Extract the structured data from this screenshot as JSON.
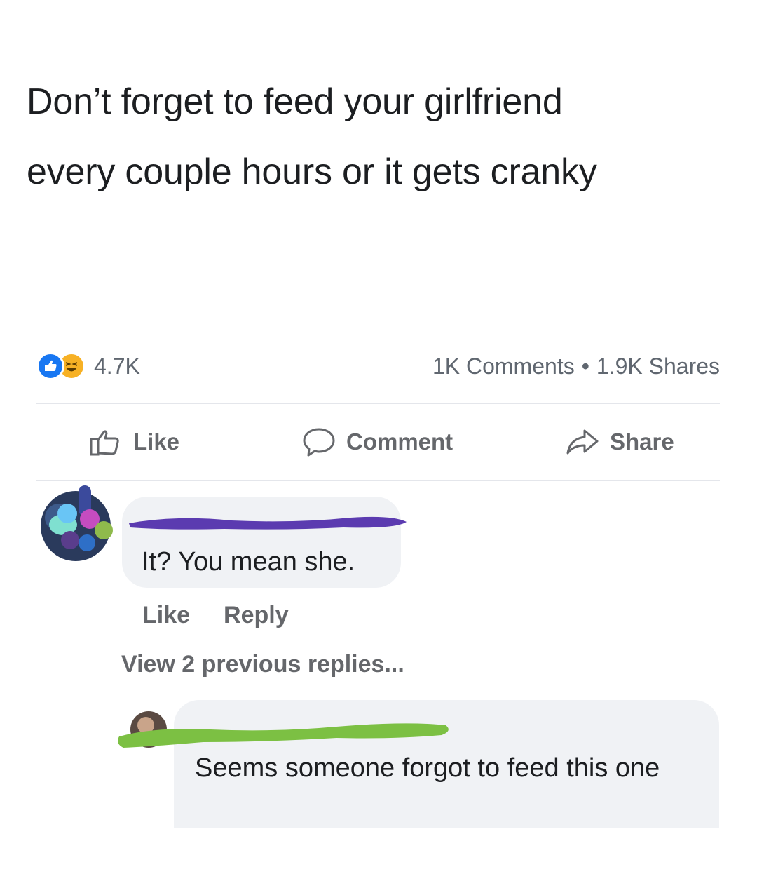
{
  "post": {
    "text_line1": "Don’t forget to feed your girlfriend",
    "text_line2": "every couple hours or it gets cranky"
  },
  "stats": {
    "reaction_count": "4.7K",
    "comments": "1K Comments",
    "separator": "•",
    "shares": "1.9K Shares",
    "reaction_icons": [
      "like-icon",
      "haha-icon"
    ]
  },
  "actions": {
    "like_label": "Like",
    "comment_label": "Comment",
    "share_label": "Share"
  },
  "comment1": {
    "text": "It? You mean she.",
    "like_label": "Like",
    "reply_label": "Reply",
    "view_replies": "View 2 previous replies..."
  },
  "comment2": {
    "text": "Seems someone forgot to feed this one"
  },
  "colors": {
    "scribble1": "#5b3bb0",
    "scribble2": "#7cc043",
    "like_blue": "#1877f2",
    "haha_yellow": "#f7b125"
  }
}
